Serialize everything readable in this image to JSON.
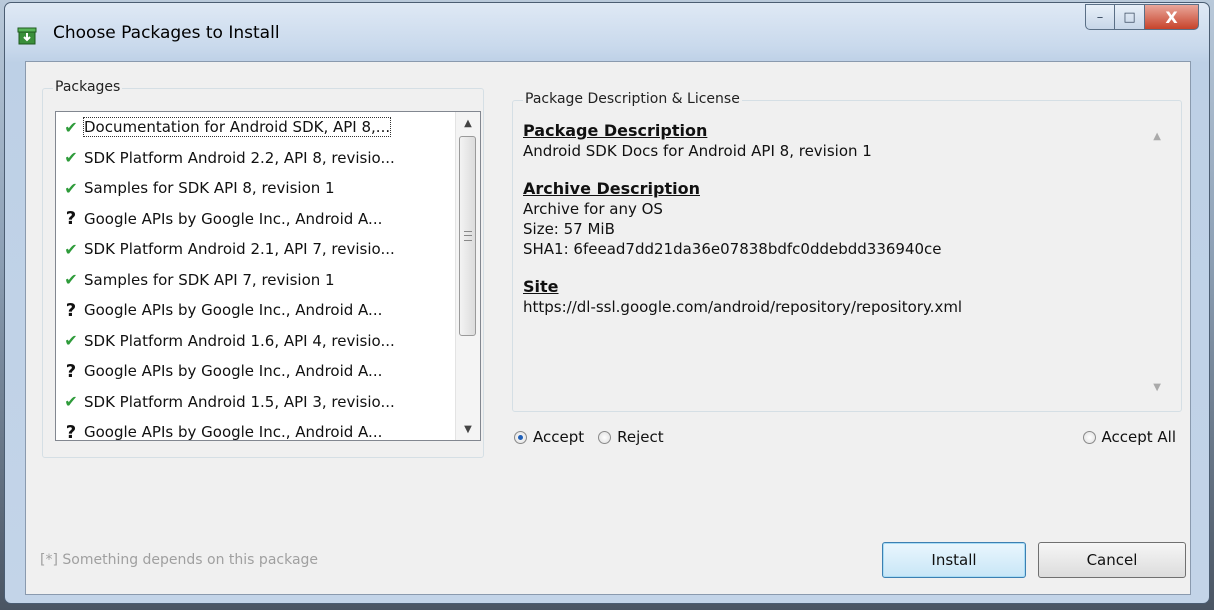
{
  "window": {
    "title": "Choose Packages to Install",
    "controls": {
      "minimize": "–",
      "maximize": "□",
      "close": "X"
    }
  },
  "packages": {
    "group_label": "Packages",
    "items": [
      {
        "label": "Documentation for Android SDK, API 8,...",
        "status": "check",
        "selected": true
      },
      {
        "label": "SDK Platform Android 2.2, API 8, revisio...",
        "status": "check"
      },
      {
        "label": "Samples for SDK API 8, revision 1",
        "status": "check"
      },
      {
        "label": "Google APIs by Google Inc., Android A...",
        "status": "question"
      },
      {
        "label": "SDK Platform Android 2.1, API 7, revisio...",
        "status": "check"
      },
      {
        "label": "Samples for SDK API 7, revision 1",
        "status": "check"
      },
      {
        "label": "Google APIs by Google Inc., Android A...",
        "status": "question"
      },
      {
        "label": "SDK Platform Android 1.6, API 4, revisio...",
        "status": "check"
      },
      {
        "label": "Google APIs by Google Inc., Android A...",
        "status": "question"
      },
      {
        "label": "SDK Platform Android 1.5, API 3, revisio...",
        "status": "check"
      },
      {
        "label": "Google APIs by Google Inc., Android A...",
        "status": "question"
      }
    ],
    "icons": {
      "check": "✔",
      "question": "?"
    }
  },
  "description": {
    "group_label": "Package Description & License",
    "package_heading": "Package Description",
    "package_text": "Android SDK Docs for Android API 8, revision 1",
    "archive_heading": "Archive Description",
    "archive_lines": [
      "Archive for any OS",
      "Size: 57 MiB",
      "SHA1: 6feead7dd21da36e07838bdfc0ddebdd336940ce"
    ],
    "site_heading": "Site",
    "site_url": "https://dl-ssl.google.com/android/repository/repository.xml"
  },
  "license": {
    "accept_label": "Accept",
    "reject_label": "Reject",
    "accept_all_label": "Accept All",
    "selected": "Accept"
  },
  "footer": {
    "note": "[*] Something depends on this package",
    "install_label": "Install",
    "cancel_label": "Cancel"
  },
  "colors": {
    "check": "#2e9b3a",
    "accent": "#3c7fb1"
  }
}
